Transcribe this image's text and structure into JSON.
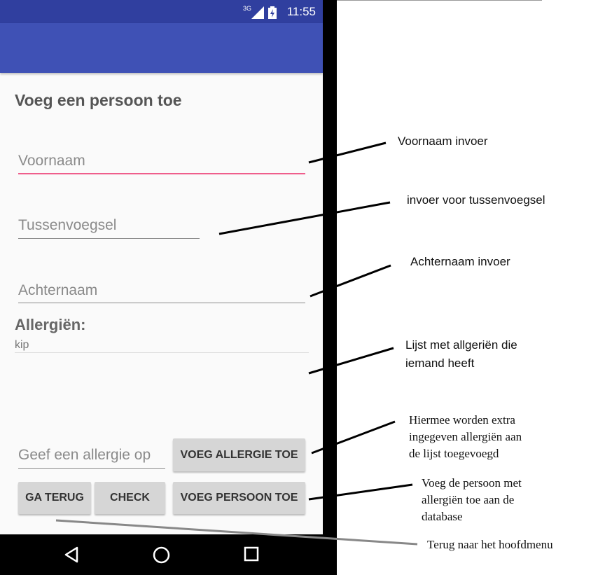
{
  "status_bar": {
    "time": "11:55",
    "network_label": "3G"
  },
  "form": {
    "title": "Voeg een persoon toe",
    "first_name_placeholder": "Voornaam",
    "infix_placeholder": "Tussenvoegsel",
    "last_name_placeholder": "Achternaam",
    "allergies_label": "Allergiën:",
    "allergies": [
      "kip"
    ],
    "allergy_input_placeholder": "Geef een allergie op",
    "add_allergy_button": "VOEG ALLERGIE TOE",
    "back_button": "GA TERUG",
    "check_button": "CHECK",
    "add_person_button": "VOEG PERSOON TOE"
  },
  "colors": {
    "status_bar": "#303f9f",
    "app_bar": "#3f51b5",
    "focus_underline": "#ef5e8c",
    "button": "#d6d6d6"
  },
  "annotations": {
    "first_name": "Voornaam invoer",
    "infix": "invoer voor tussenvoegsel",
    "last_name": "Achternaam invoer",
    "allergy_list_line1": "Lijst met allgeriën die",
    "allergy_list_line2": "iemand heeft",
    "add_allergy_line1": "Hiermee worden extra",
    "add_allergy_line2": "ingegeven allergiën aan",
    "add_allergy_line3": "de lijst toegevoegd",
    "add_person_line1": "Voeg de persoon met",
    "add_person_line2": "allergiën toe aan de",
    "add_person_line3": "database",
    "back": "Terug naar het hoofdmenu"
  },
  "nav_icons": [
    "back-triangle-icon",
    "home-circle-icon",
    "recents-square-icon"
  ]
}
